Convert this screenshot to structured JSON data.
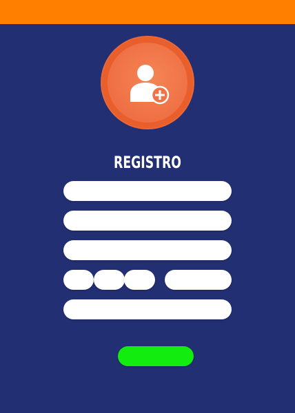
{
  "header": {
    "bar_color": "#ff7f00"
  },
  "avatar": {
    "icon": "add-user-icon",
    "accent": "#e95f2c"
  },
  "form": {
    "title": "REGISTRO",
    "fields": {
      "field1": "",
      "field2": "",
      "field3": "",
      "date_day": "",
      "date_month": "",
      "date_year": "",
      "extra": "",
      "field5": ""
    },
    "submit_label": ""
  },
  "colors": {
    "background": "#232f73",
    "submit": "#12ec0f",
    "field": "#ffffff"
  }
}
